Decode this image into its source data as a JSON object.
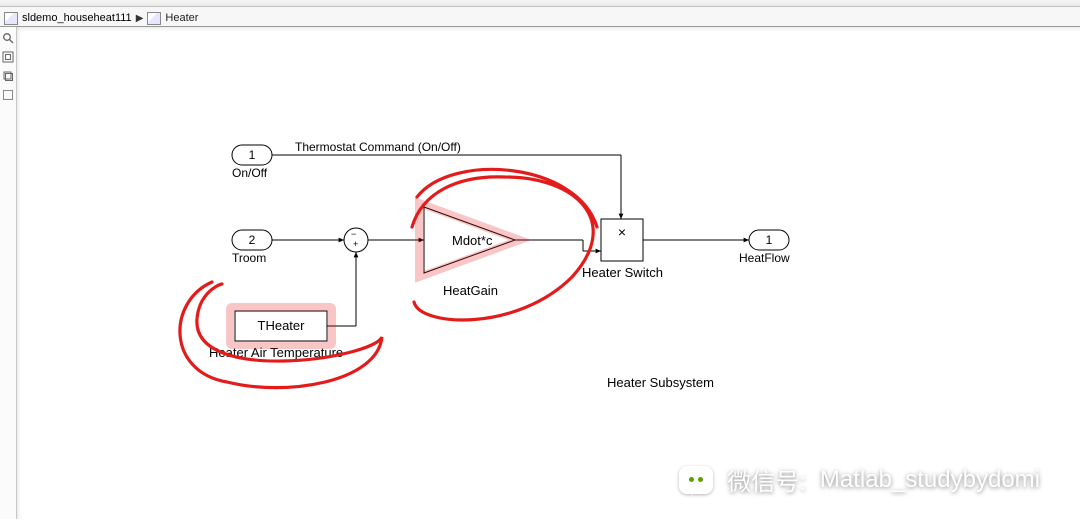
{
  "breadcrumb": {
    "root": "sldemo_househeat111",
    "current": "Heater"
  },
  "inports": [
    {
      "num": "1",
      "label": "On/Off",
      "signal_label": "Thermostat Command (On/Off)"
    },
    {
      "num": "2",
      "label": "Troom"
    }
  ],
  "outport": {
    "num": "1",
    "label": "HeatFlow"
  },
  "sum": {
    "signs": "−  +"
  },
  "gain": {
    "text": "Mdot*c",
    "label": "HeatGain"
  },
  "product": {
    "symbol": "×",
    "label": "Heater Switch"
  },
  "constant": {
    "text": "THeater",
    "label": "Heater Air Temperature"
  },
  "annotation": "Heater Subsystem",
  "watermark": {
    "prefix": "微信号:",
    "id": "Matlab_studybydomi"
  },
  "toolbar_icons": [
    "search-icon",
    "fit-icon",
    "layers-icon",
    "blank-icon"
  ]
}
